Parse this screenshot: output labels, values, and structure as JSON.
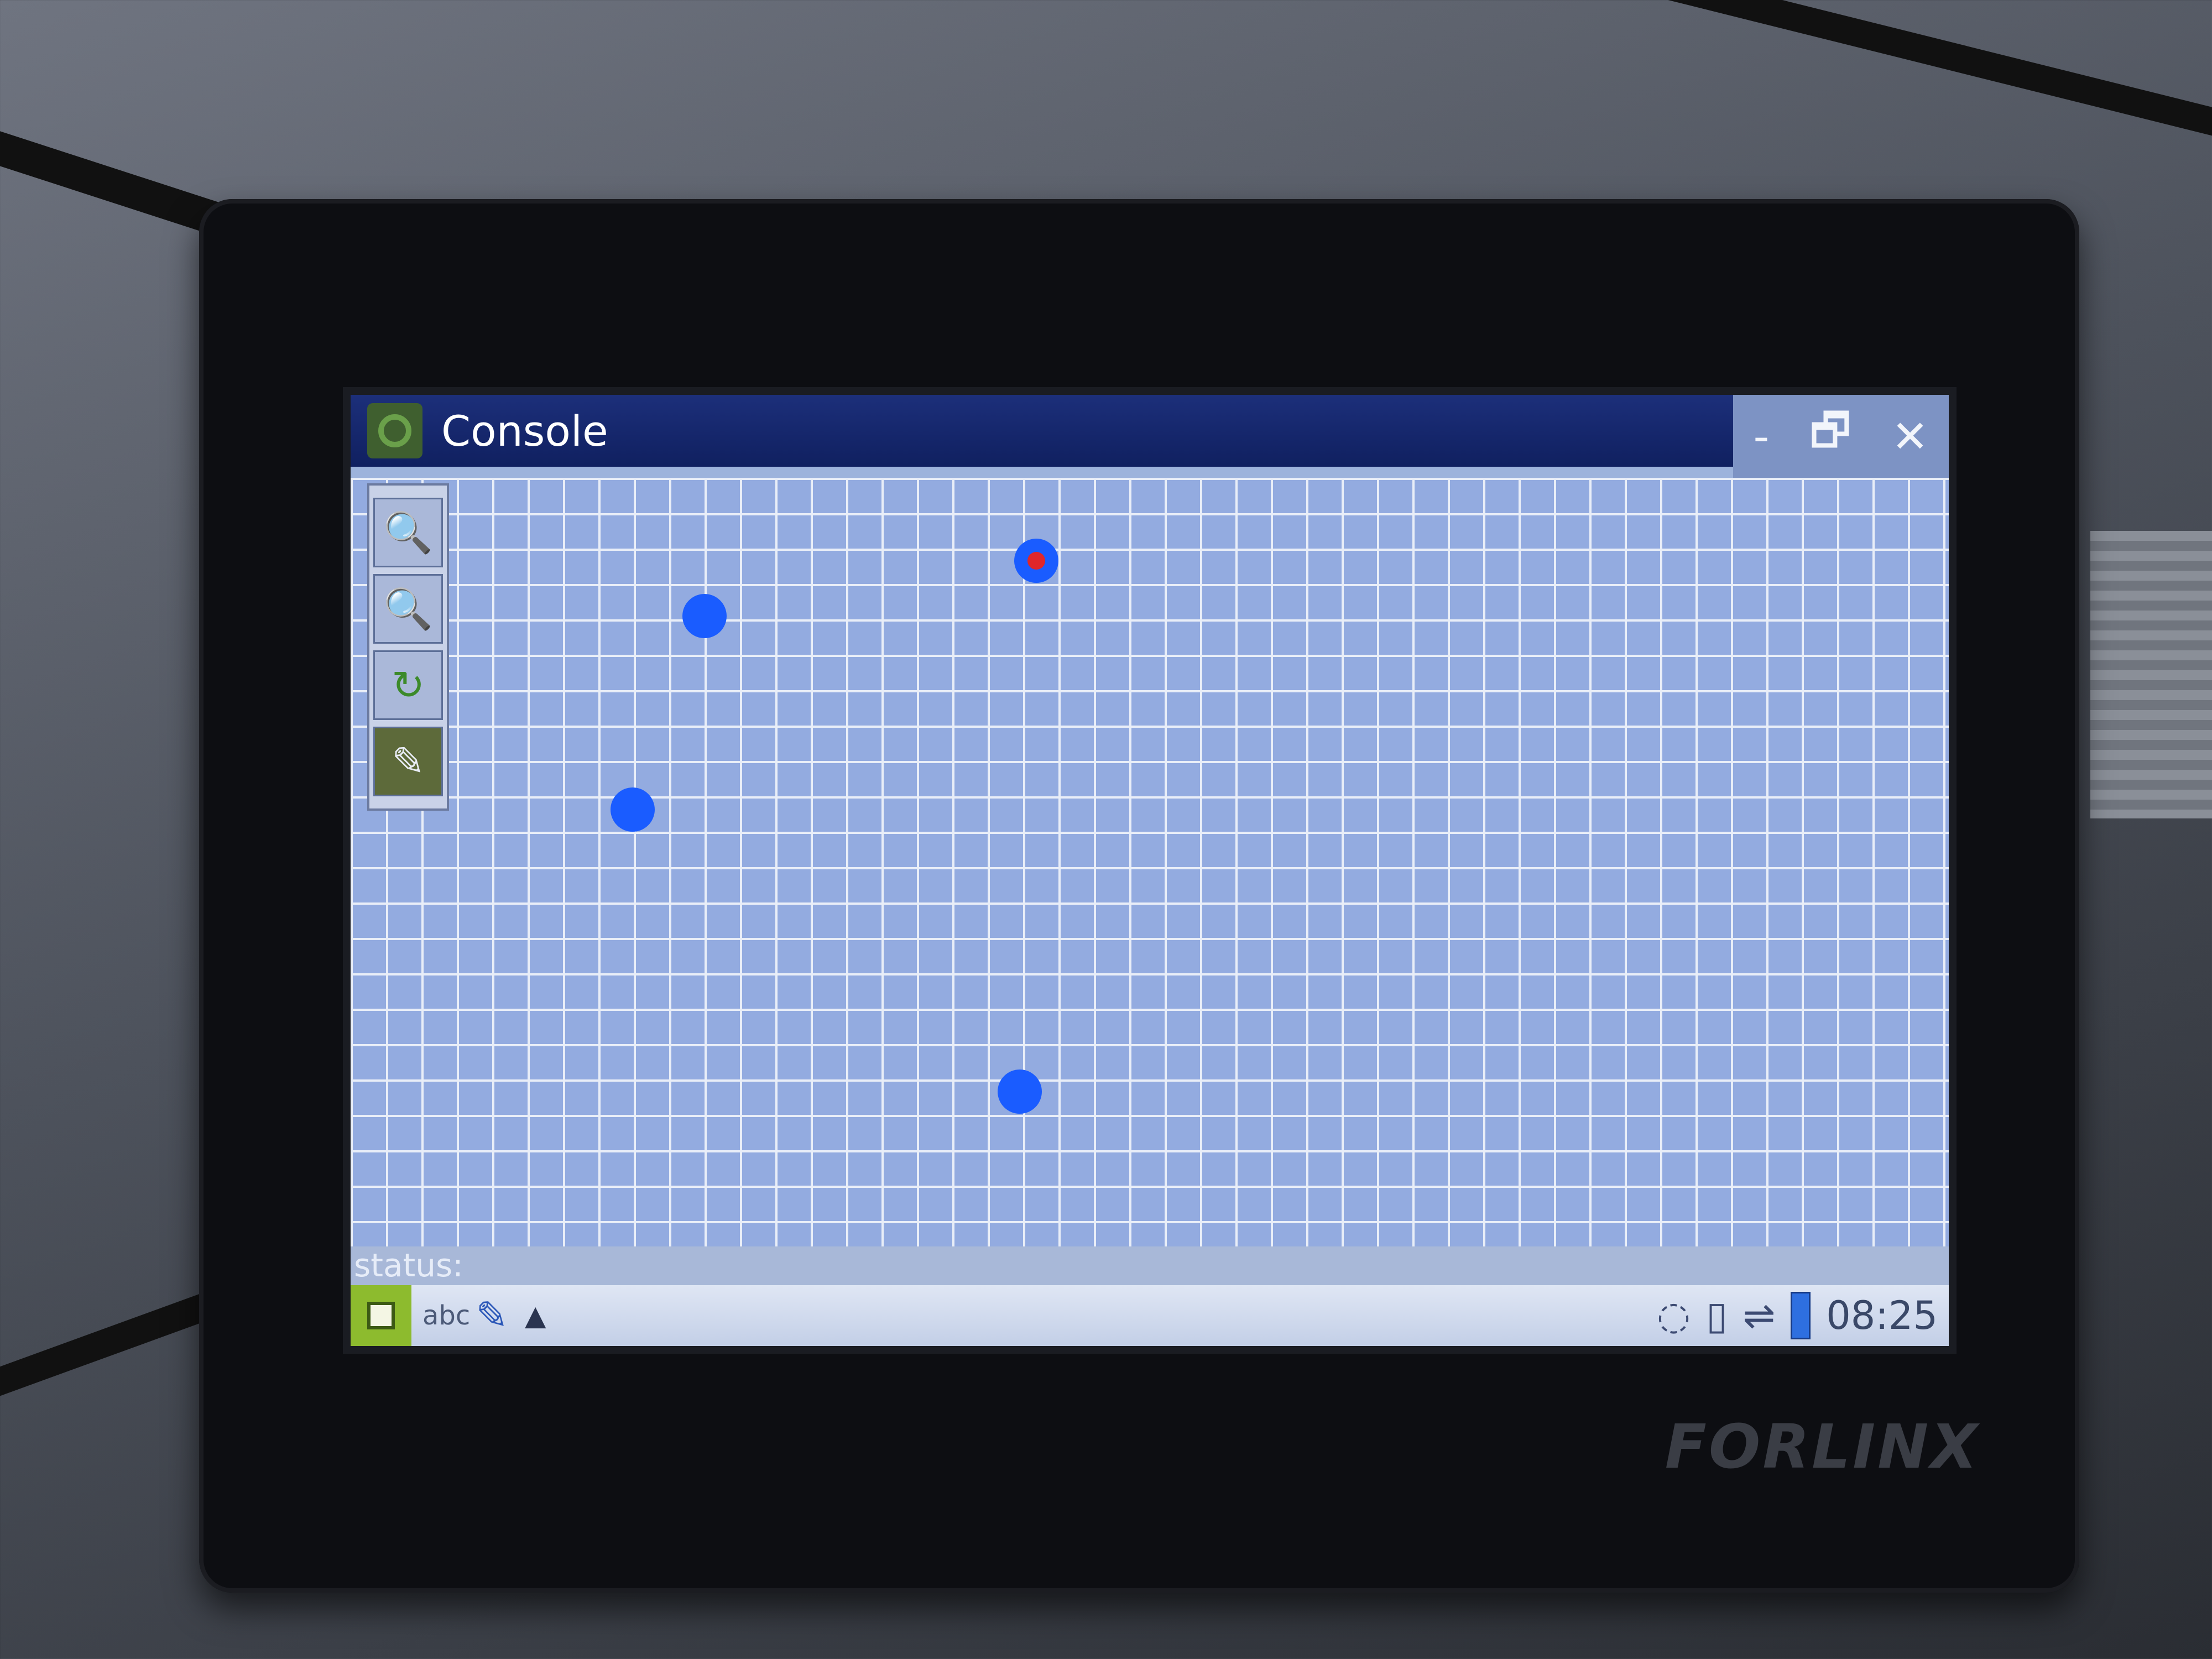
{
  "window": {
    "title": "Console",
    "controls": {
      "minimize": "-",
      "restore": "🗗",
      "close": "✕"
    }
  },
  "toolbox": {
    "tools": [
      {
        "name": "zoom-in",
        "glyph": "🔍"
      },
      {
        "name": "zoom-out",
        "glyph": "🔍"
      },
      {
        "name": "rotate",
        "glyph": "↻"
      },
      {
        "name": "edit",
        "glyph": "✎"
      }
    ]
  },
  "canvas": {
    "points": [
      {
        "selected": true
      },
      {
        "selected": false
      },
      {
        "selected": false
      },
      {
        "selected": false
      }
    ]
  },
  "statusbar": {
    "label": "status:"
  },
  "taskbar": {
    "input_method": "abc",
    "pen_glyph": "✎",
    "arrow_glyph": "▲",
    "clock": "08:25"
  },
  "device": {
    "brand": "FORLINX"
  },
  "colors": {
    "title_bar": "#102060",
    "canvas_bg": "#93abe0",
    "grid_line": "#e9eef8",
    "point": "#1a5cff",
    "selected_point_center": "#e0262a",
    "taskbar": "#c3cfe7"
  }
}
